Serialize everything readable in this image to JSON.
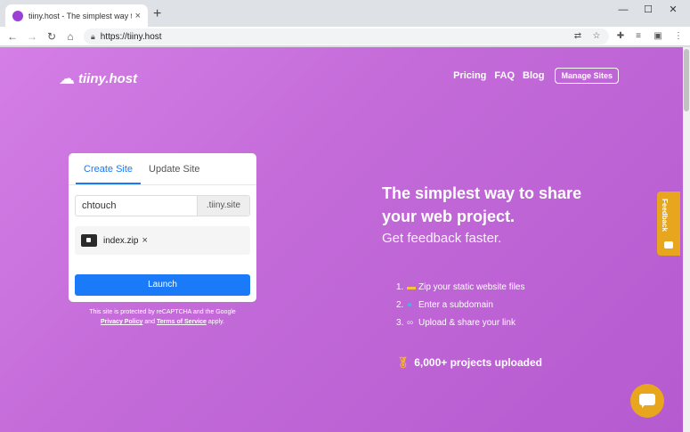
{
  "browser": {
    "tab_title": "tiiny.host - The simplest way to",
    "tab_close": "×",
    "new_tab": "+",
    "url": "https://tiiny.host",
    "window_controls": {
      "minimize": "—",
      "maximize": "☐",
      "close": "✕"
    }
  },
  "header": {
    "logo_text": "tiiny.host",
    "nav": {
      "pricing": "Pricing",
      "faq": "FAQ",
      "blog": "Blog",
      "manage": "Manage Sites"
    }
  },
  "form": {
    "tabs": {
      "create": "Create Site",
      "update": "Update Site"
    },
    "subdomain_value": "chtouch",
    "subdomain_suffix": ".tiiny.site",
    "file_name": "index.zip",
    "file_remove": "×",
    "launch_label": "Launch",
    "captcha_line": "This site is protected by reCAPTCHA and the Google",
    "privacy_label": "Privacy Policy",
    "and": "and",
    "terms_label": "Terms of Service",
    "apply": "apply."
  },
  "hero": {
    "headline": "The simplest way to share your web project.",
    "subheadline": "Get feedback faster."
  },
  "steps": [
    {
      "num": "1.",
      "icon": "folder-icon",
      "text": "Zip your static website files"
    },
    {
      "num": "2.",
      "icon": "globe-icon",
      "text": "Enter a subdomain"
    },
    {
      "num": "3.",
      "icon": "link-icon",
      "text": "Upload & share your link"
    }
  ],
  "projects": "6,000+ projects uploaded",
  "feedback_tab": "Feedback",
  "colors": {
    "accent": "#1a7af8",
    "gradient_start": "#d47ee6",
    "gradient_end": "#b55ad0",
    "widget": "#e8a51e"
  }
}
